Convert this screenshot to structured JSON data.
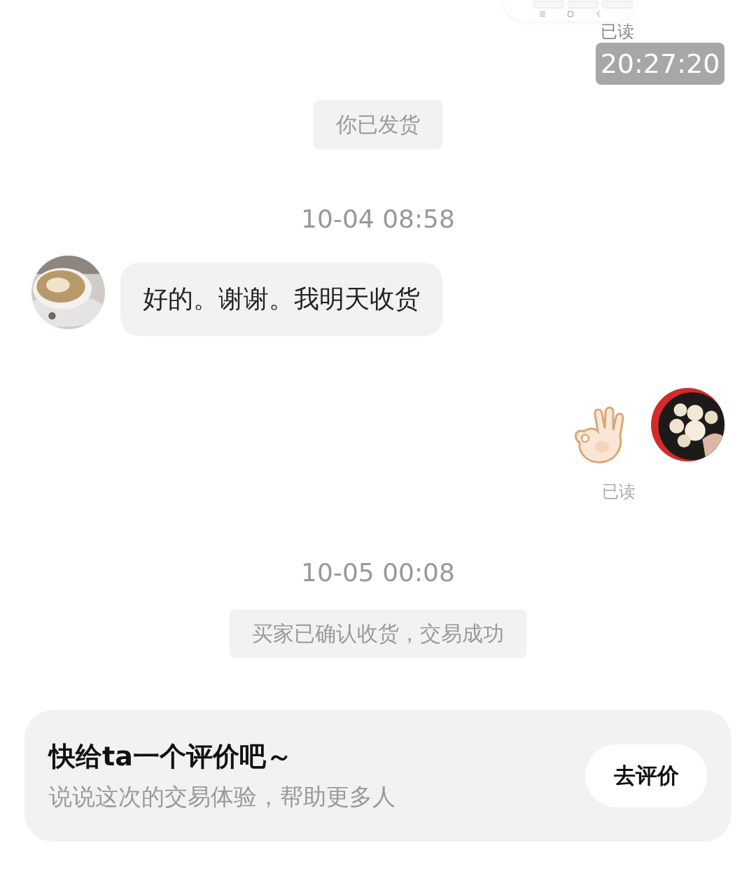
{
  "top_read_label": "已读",
  "time_badge": "20:27:20",
  "messages": [
    {
      "kind": "notice",
      "text": "你已发货"
    },
    {
      "kind": "timestamp",
      "text": "10-04 08:58"
    },
    {
      "kind": "incoming",
      "text": "好的。谢谢。我明天收货"
    },
    {
      "kind": "sticker",
      "read_label": "已读"
    },
    {
      "kind": "timestamp",
      "text": "10-05 00:08"
    },
    {
      "kind": "notice",
      "text": "买家已确认收货，交易成功"
    }
  ],
  "review_card": {
    "title": "快给ta一个评价吧～",
    "subtitle": "说说这次的交易体验，帮助更多人",
    "button": "去评价"
  }
}
